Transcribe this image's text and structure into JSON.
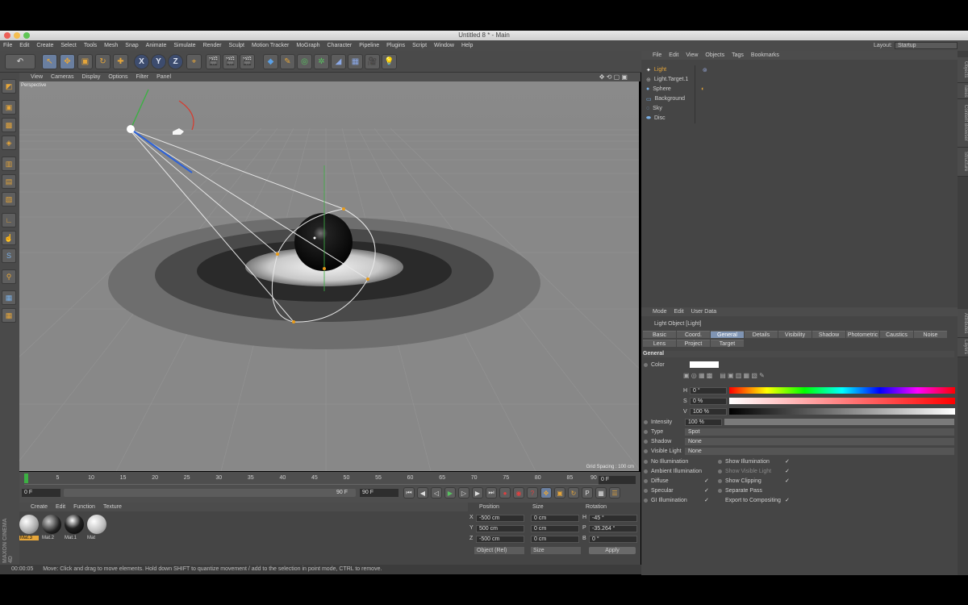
{
  "window": {
    "title": "Untitled 8 * - Main"
  },
  "menu": [
    "File",
    "Edit",
    "Create",
    "Select",
    "Tools",
    "Mesh",
    "Snap",
    "Animate",
    "Simulate",
    "Render",
    "Sculpt",
    "Motion Tracker",
    "MoGraph",
    "Character",
    "Pipeline",
    "Plugins",
    "Script",
    "Window",
    "Help"
  ],
  "layout": {
    "label": "Layout:",
    "value": "Startup"
  },
  "toolbar": {
    "axis_x": "X",
    "axis_y": "Y",
    "axis_z": "Z"
  },
  "viewport": {
    "menu": [
      "View",
      "Cameras",
      "Display",
      "Options",
      "Filter",
      "Panel"
    ],
    "label": "Perspective",
    "grid_spacing": "Grid Spacing : 100 cm"
  },
  "timeline": {
    "ticks": [
      "0",
      "5",
      "10",
      "15",
      "20",
      "25",
      "30",
      "35",
      "40",
      "45",
      "50",
      "55",
      "60",
      "65",
      "70",
      "75",
      "80",
      "85",
      "90"
    ],
    "frame_field": "0 F",
    "current_frame": "0 F",
    "start": "0 F",
    "end": "90 F",
    "range_end": "90 F"
  },
  "materials": {
    "menu": [
      "Create",
      "Edit",
      "Function",
      "Texture"
    ],
    "items": [
      "Mat.3",
      "Mat.2",
      "Mat.1",
      "Mat"
    ]
  },
  "coords": {
    "headers": {
      "position": "Position",
      "size": "Size",
      "rotation": "Rotation"
    },
    "rows": [
      {
        "axis": "X",
        "pos": "-500 cm",
        "size": "0 cm",
        "rot_label": "H",
        "rot": "-45 °"
      },
      {
        "axis": "Y",
        "pos": "500 cm",
        "size": "0 cm",
        "rot_label": "P",
        "rot": "-35.264 °"
      },
      {
        "axis": "Z",
        "pos": "-500 cm",
        "size": "0 cm",
        "rot_label": "B",
        "rot": "0 °"
      }
    ],
    "mode": "Object (Rel)",
    "size_mode": "Size",
    "apply": "Apply"
  },
  "status": {
    "time": "00:00:05",
    "message": "Move: Click and drag to move elements. Hold down SHIFT to quantize movement / add to the selection in point mode, CTRL to remove."
  },
  "objects": {
    "menu": [
      "File",
      "Edit",
      "View",
      "Objects",
      "Tags",
      "Bookmarks"
    ],
    "items": [
      "Light",
      "Light.Target.1",
      "Sphere",
      "Background",
      "Sky",
      "Disc"
    ]
  },
  "attributes": {
    "menu": [
      "Mode",
      "Edit",
      "User Data"
    ],
    "title": "Light Object [Light]",
    "tabs_row1": [
      "Basic",
      "Coord.",
      "General",
      "Details",
      "Visibility",
      "Shadow",
      "Photometric",
      "Caustics",
      "Noise"
    ],
    "tabs_row2": [
      "Lens",
      "Project",
      "Target"
    ],
    "section": "General",
    "color_label": "Color",
    "h_label": "H",
    "h_value": "0 °",
    "s_label": "S",
    "s_value": "0 %",
    "v_label": "V",
    "v_value": "100 %",
    "intensity_label": "Intensity",
    "intensity_value": "100 %",
    "type_label": "Type",
    "type_value": "Spot",
    "shadow_label": "Shadow",
    "shadow_value": "None",
    "visible_label": "Visible Light",
    "visible_value": "None",
    "checks_left": [
      "No Illumination",
      "Ambient Illumination",
      "Diffuse",
      "Specular",
      "GI Illumination"
    ],
    "checks_right": [
      "Show Illumination",
      "Show Visible Light",
      "Show Clipping",
      "Separate Pass",
      "Export to Compositing"
    ]
  },
  "side_tabs": [
    "Objects",
    "Takes",
    "Content Browser",
    "Structure"
  ],
  "side_tabs2": [
    "Attributes",
    "Layers"
  ],
  "logo": "MAXON CINEMA 4D"
}
